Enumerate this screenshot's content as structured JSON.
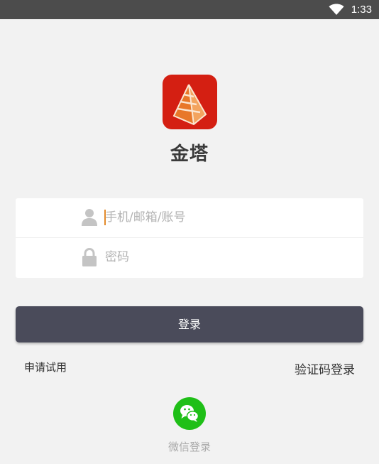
{
  "status_bar": {
    "time": "1:33",
    "icons": [
      "wifi-icon"
    ]
  },
  "app": {
    "name": "金塔",
    "logo_icon": "pyramid-icon",
    "logo_color": "#d41f12"
  },
  "form": {
    "account": {
      "placeholder": "手机/邮箱/账号",
      "value": "",
      "icon": "user-icon"
    },
    "password": {
      "placeholder": "密码",
      "value": "",
      "icon": "lock-icon"
    }
  },
  "login_button": {
    "label": "登录",
    "color": "#4a4b5a"
  },
  "links": {
    "trial": "申请试用",
    "code_login": "验证码登录"
  },
  "wechat": {
    "icon": "wechat-icon",
    "label": "微信登录",
    "color": "#1fbf17"
  }
}
